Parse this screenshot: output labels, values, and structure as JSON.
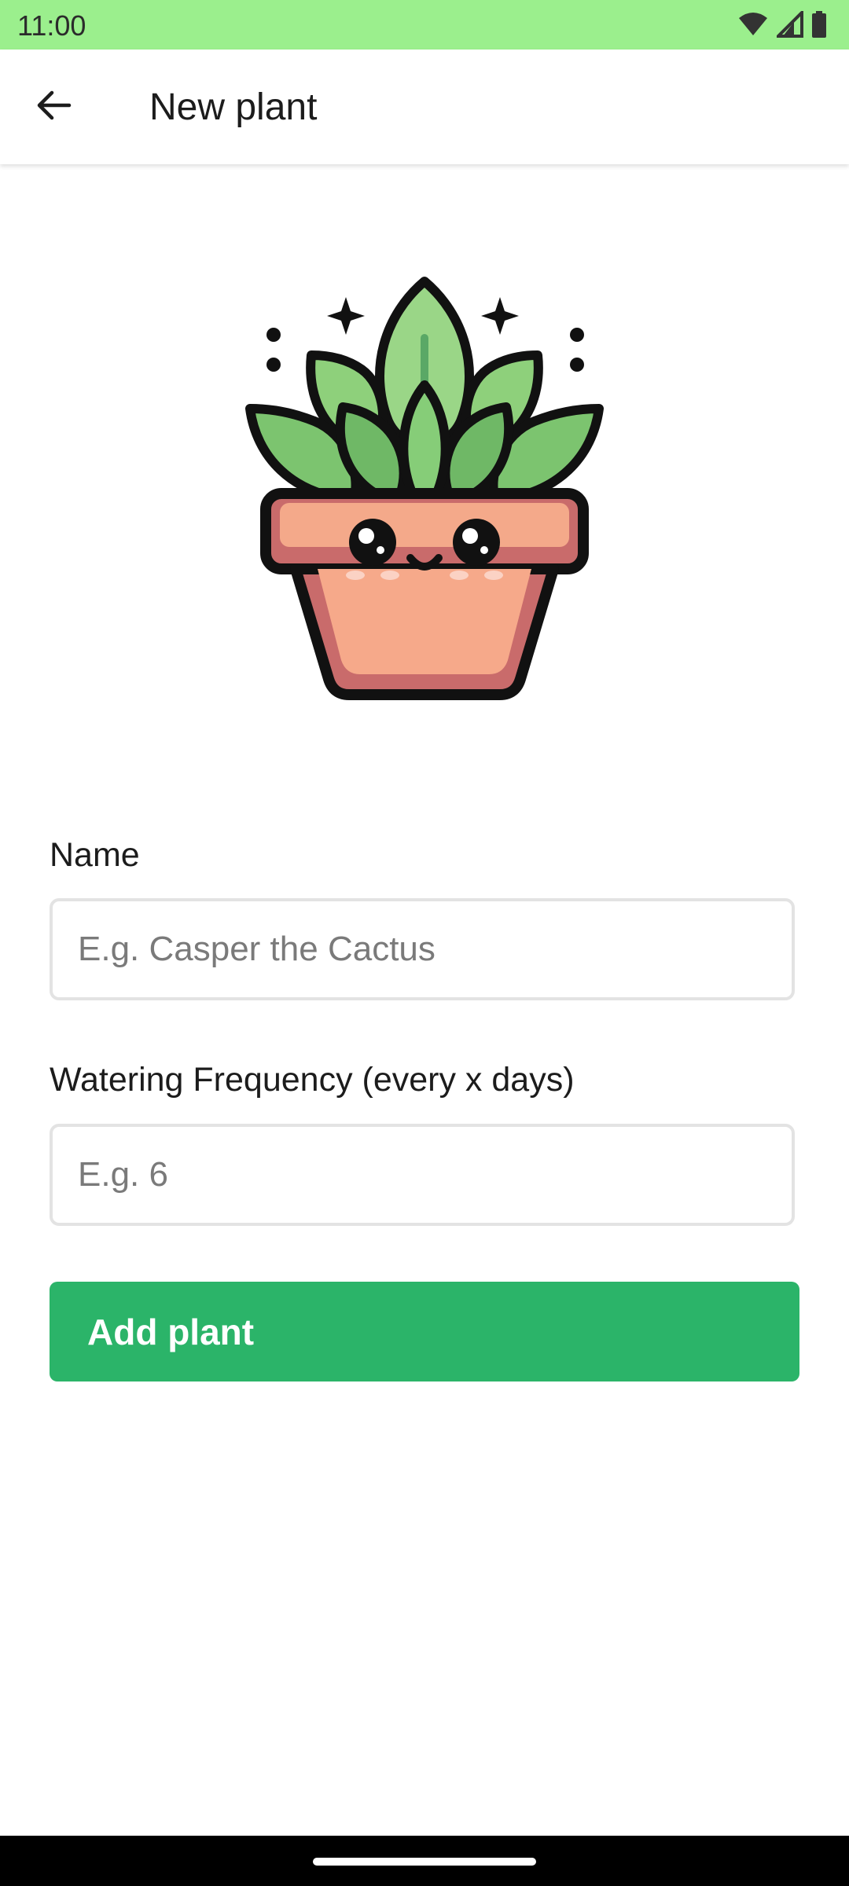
{
  "status_bar": {
    "time": "11:00",
    "icons": [
      "wifi-icon",
      "signal-icon",
      "battery-icon"
    ],
    "background": "#9bef8d"
  },
  "app_bar": {
    "back_icon": "arrow-back-icon",
    "title": "New plant"
  },
  "illustration": {
    "name": "potted-plant-mascot"
  },
  "form": {
    "name_label": "Name",
    "name_placeholder": "E.g. Casper the Cactus",
    "name_value": "",
    "watering_label": "Watering Frequency (every x days)",
    "watering_placeholder": "E.g. 6",
    "watering_value": ""
  },
  "actions": {
    "add_label": "Add plant",
    "add_color": "#2bb469"
  }
}
